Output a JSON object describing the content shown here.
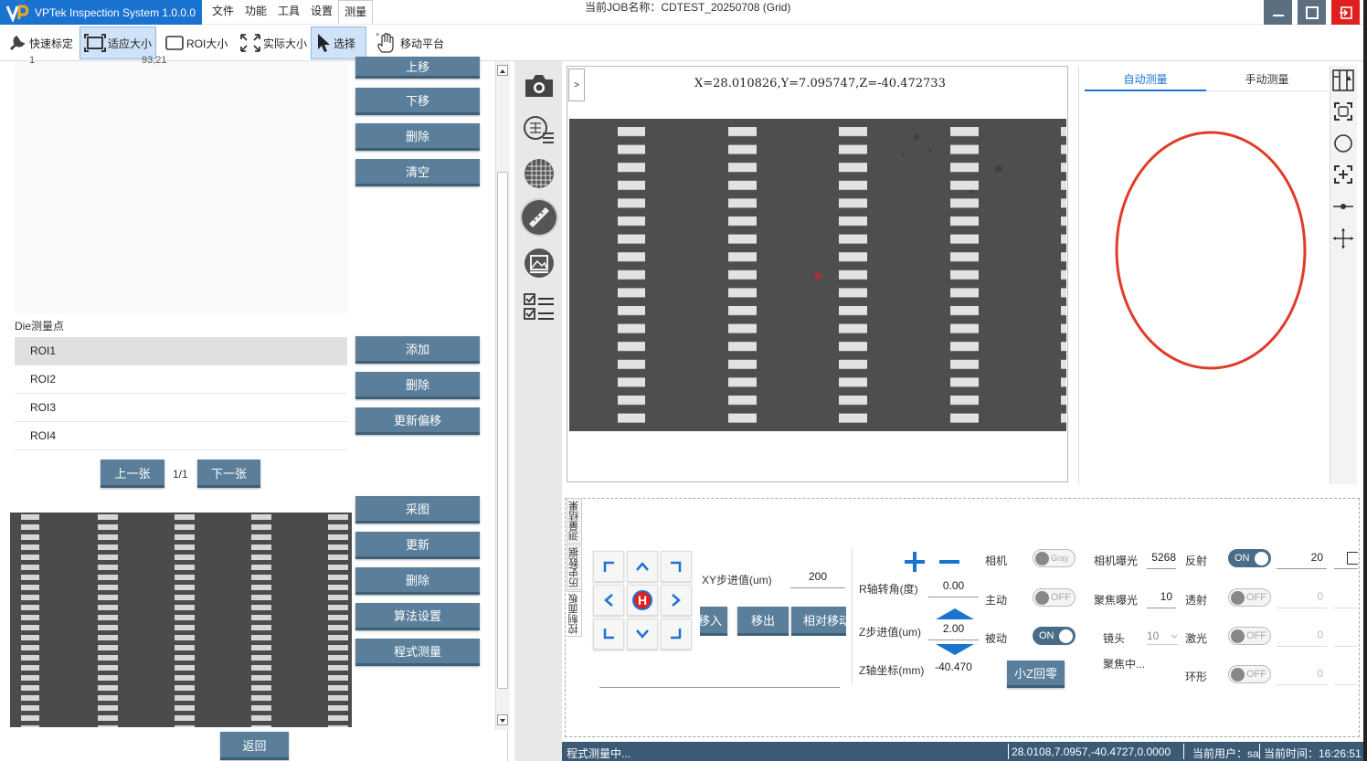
{
  "app": {
    "title": "VPTek Inspection System 1.0.0.0",
    "job_label": "当前JOB名称：CDTEST_20250708 (Grid)"
  },
  "menu": [
    "文件",
    "功能",
    "工具",
    "设置",
    "测量"
  ],
  "toolbar": {
    "quick_calib": "快速标定",
    "fit_size": "适应大小",
    "roi_size": "ROI大小",
    "actual_size": "实际大小",
    "select": "选择",
    "move_stage": "移动平台"
  },
  "left": {
    "top_row_num": "1",
    "top_row_val": "93,21",
    "top_buttons": [
      "上移",
      "下移",
      "删除",
      "清空"
    ],
    "die_label": "Die测量点",
    "roi_items": [
      "ROI1",
      "ROI2",
      "ROI3",
      "ROI4"
    ],
    "roi_buttons": [
      "添加",
      "删除",
      "更新偏移"
    ],
    "prev_btn": "上一张",
    "page": "1/1",
    "next_btn": "下一张",
    "bottom_buttons": [
      "采图",
      "更新",
      "删除",
      "算法设置",
      "程式测量"
    ],
    "back_btn": "返回"
  },
  "viewer": {
    "expand": ">",
    "coords": "X=28.010826,Y=7.095747,Z=-40.472733"
  },
  "measure_tabs": {
    "auto": "自动测量",
    "manual": "手动测量"
  },
  "bottom_tabs": [
    "测量结果",
    "历史数据",
    "控制面板"
  ],
  "control": {
    "home": "H",
    "xy_step_label": "XY步进值(um)",
    "xy_step": "200",
    "move_in": "移入",
    "move_out": "移出",
    "rel_move": "相对移动",
    "r_angle_label": "R轴转角(度)",
    "r_angle": "0.00",
    "z_step_label": "Z步进值(um)",
    "z_step": "2.00",
    "z_coord_label": "Z轴坐标(mm)",
    "z_coord": "-40.470",
    "camera_label": "相机",
    "camera_toggle": "Gray",
    "active_label": "主动",
    "active_toggle": "OFF",
    "passive_label": "被动",
    "passive_toggle": "ON",
    "z_home_btn": "小Z回零",
    "cam_exposure_label": "相机曝光",
    "cam_exposure": "5268",
    "focus_exposure_label": "聚焦曝光",
    "focus_exposure": "10",
    "lens_label": "镜头",
    "lens": "10",
    "focusing": "聚焦中...",
    "reflect_label": "反射",
    "reflect_toggle": "ON",
    "reflect_val": "20",
    "transmit_label": "透射",
    "transmit_toggle": "OFF",
    "transmit_val": "0",
    "laser_label": "激光",
    "laser_toggle": "OFF",
    "laser_val": "0",
    "ring_label": "环形",
    "ring_toggle": "OFF",
    "ring_val": "0"
  },
  "status": {
    "state": "程式测量中...",
    "coords": "28.0108,7.0957,-40.4727,0.0000",
    "user": "当前用户：sa",
    "time": "当前时间：16:26:51"
  },
  "colors": {
    "brand": "#1b73d1",
    "button": "#5b7f9b",
    "status_bar": "#3b5a76",
    "ellipse": "#e03c28",
    "close": "#e02020"
  }
}
